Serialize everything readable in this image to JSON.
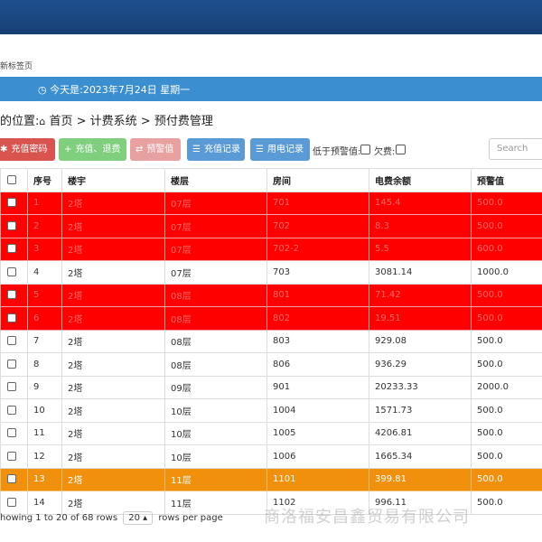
{
  "tab": {
    "label": "新标签页"
  },
  "date_bar": {
    "text": "今天是:2023年7月24日 星期一"
  },
  "breadcrumb": {
    "prefix": "的位置:",
    "path": "首页 > 计费系统 > 预付费管理"
  },
  "toolbar": {
    "recharge_password": "充值密码",
    "recharge_refund": "充值、退费",
    "warning_value": "预警值",
    "recharge_records": "充值记录",
    "usage_records": "用电记录",
    "below_warning_label": "低于预警值:",
    "arrears_label": "欠费:"
  },
  "search": {
    "placeholder": "Search"
  },
  "table": {
    "headers": [
      "序号",
      "楼宇",
      "楼层",
      "房间",
      "电费余额",
      "预警值"
    ],
    "rows": [
      {
        "no": "1",
        "building": "2塔",
        "floor": "07层",
        "room": "701",
        "balance": "145.4",
        "warning": "500.0",
        "status": "red"
      },
      {
        "no": "2",
        "building": "2塔",
        "floor": "07层",
        "room": "702",
        "balance": "8.3",
        "warning": "500.0",
        "status": "red"
      },
      {
        "no": "3",
        "building": "2塔",
        "floor": "07层",
        "room": "702-2",
        "balance": "5.5",
        "warning": "600.0",
        "status": "red"
      },
      {
        "no": "4",
        "building": "2塔",
        "floor": "07层",
        "room": "703",
        "balance": "3081.14",
        "warning": "1000.0",
        "status": "normal"
      },
      {
        "no": "5",
        "building": "2塔",
        "floor": "08层",
        "room": "801",
        "balance": "71.42",
        "warning": "500.0",
        "status": "red"
      },
      {
        "no": "6",
        "building": "2塔",
        "floor": "08层",
        "room": "802",
        "balance": "19.51",
        "warning": "500.0",
        "status": "red"
      },
      {
        "no": "7",
        "building": "2塔",
        "floor": "08层",
        "room": "803",
        "balance": "929.08",
        "warning": "500.0",
        "status": "normal"
      },
      {
        "no": "8",
        "building": "2塔",
        "floor": "08层",
        "room": "806",
        "balance": "936.29",
        "warning": "500.0",
        "status": "normal"
      },
      {
        "no": "9",
        "building": "2塔",
        "floor": "09层",
        "room": "901",
        "balance": "20233.33",
        "warning": "2000.0",
        "status": "normal"
      },
      {
        "no": "10",
        "building": "2塔",
        "floor": "10层",
        "room": "1004",
        "balance": "1571.73",
        "warning": "500.0",
        "status": "normal"
      },
      {
        "no": "11",
        "building": "2塔",
        "floor": "10层",
        "room": "1005",
        "balance": "4206.81",
        "warning": "500.0",
        "status": "normal"
      },
      {
        "no": "12",
        "building": "2塔",
        "floor": "10层",
        "room": "1006",
        "balance": "1665.34",
        "warning": "500.0",
        "status": "normal"
      },
      {
        "no": "13",
        "building": "2塔",
        "floor": "11层",
        "room": "1101",
        "balance": "399.81",
        "warning": "500.0",
        "status": "orange"
      },
      {
        "no": "14",
        "building": "2塔",
        "floor": "11层",
        "room": "1102",
        "balance": "996.11",
        "warning": "500.0",
        "status": "normal"
      }
    ]
  },
  "footer": {
    "showing": "howing 1 to 20 of 68 rows",
    "page_size": "20",
    "rows_per_page": "rows per page"
  },
  "watermark": {
    "text": "商洛福安昌鑫贸易有限公司"
  },
  "colors": {
    "alarm_row": "#ff0000",
    "low_row": "#f0900c",
    "date_bar": "#3b8fd0",
    "header_bar": "#1d4f8f"
  },
  "icons": {
    "recharge_password": "gear-icon",
    "recharge_refund": "plus-icon",
    "warning_value": "refresh-icon",
    "records": "list-icon",
    "home": "home-icon",
    "date": "clock-icon"
  }
}
